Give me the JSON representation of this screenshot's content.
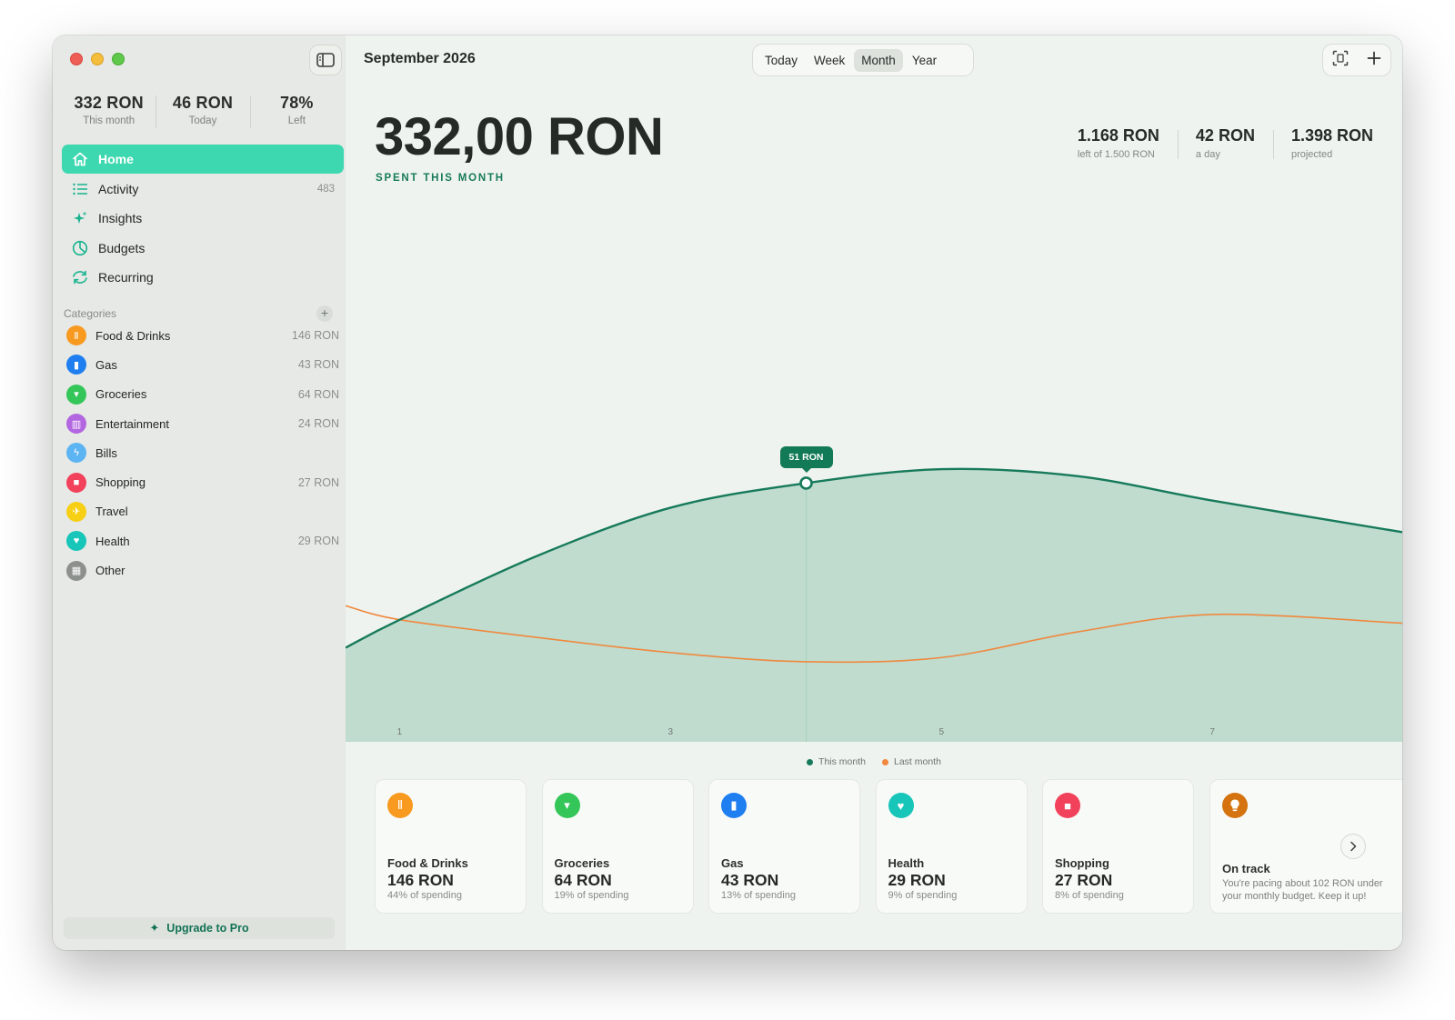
{
  "sidebar": {
    "stats": [
      {
        "value": "332 RON",
        "label": "This month"
      },
      {
        "value": "46 RON",
        "label": "Today"
      },
      {
        "value": "78%",
        "label": "Left"
      }
    ],
    "nav": [
      {
        "label": "Home",
        "icon": "house-icon",
        "active": true
      },
      {
        "label": "Activity",
        "icon": "list-icon",
        "count": "483"
      },
      {
        "label": "Insights",
        "icon": "sparkles-icon"
      },
      {
        "label": "Budgets",
        "icon": "pie-chart-icon"
      },
      {
        "label": "Recurring",
        "icon": "recurring-arrows-icon"
      }
    ],
    "categories_header": "Categories",
    "categories": [
      {
        "name": "Food & Drinks",
        "amount": "146 RON",
        "color": "#f79a1f",
        "icon": "fork-knife-icon"
      },
      {
        "name": "Gas",
        "amount": "43 RON",
        "color": "#1f7ef0",
        "icon": "fuel-pump-icon"
      },
      {
        "name": "Groceries",
        "amount": "64 RON",
        "color": "#34c659",
        "icon": "cart-icon"
      },
      {
        "name": "Entertainment",
        "amount": "24 RON",
        "color": "#b266e0",
        "icon": "popcorn-icon"
      },
      {
        "name": "Bills",
        "amount": "",
        "color": "#5db4f2",
        "icon": "bolt-icon"
      },
      {
        "name": "Shopping",
        "amount": "27 RON",
        "color": "#f2415b",
        "icon": "bag-icon"
      },
      {
        "name": "Travel",
        "amount": "",
        "color": "#f7cf14",
        "icon": "airplane-icon"
      },
      {
        "name": "Health",
        "amount": "29 RON",
        "color": "#17c5b9",
        "icon": "heart-icon"
      },
      {
        "name": "Other",
        "amount": "",
        "color": "#8d918e",
        "icon": "grid-icon"
      }
    ],
    "upgrade_label": "Upgrade to Pro"
  },
  "header": {
    "period": "September 2026",
    "segments": [
      "Today",
      "Week",
      "Month",
      "Year"
    ],
    "selected_segment": "Month"
  },
  "summary": {
    "amount": "332,00 RON",
    "caption": "SPENT THIS MONTH",
    "kpis": [
      {
        "value": "1.168 RON",
        "label": "left of 1.500 RON"
      },
      {
        "value": "42 RON",
        "label": "a day"
      },
      {
        "value": "1.398 RON",
        "label": "projected"
      }
    ]
  },
  "chart_data": {
    "type": "area",
    "x_ticks": [
      "1",
      "3",
      "5",
      "7"
    ],
    "series": [
      {
        "name": "This month",
        "color": "#177a5b",
        "x": [
          0.6,
          1,
          2,
          3,
          4,
          5,
          6,
          7,
          8.4
        ],
        "values": [
          4,
          12,
          30,
          44,
          51,
          55,
          53,
          46,
          37
        ]
      },
      {
        "name": "Last month",
        "color": "#f0883e",
        "x": [
          0.6,
          1,
          2,
          3,
          4,
          5,
          6,
          7,
          8.4
        ],
        "values": [
          16,
          12,
          7,
          2.6,
          0,
          1.2,
          8.5,
          13.5,
          11
        ]
      }
    ],
    "xlim": [
      0.6,
      8.4
    ],
    "ylim": [
      -33,
      75
    ],
    "highlight": {
      "x": 4,
      "label": "51 RON"
    }
  },
  "cards": [
    {
      "name": "Food & Drinks",
      "amount": "146 RON",
      "pct": "44% of spending",
      "color": "#f79a1f",
      "icon": "fork-knife-icon"
    },
    {
      "name": "Groceries",
      "amount": "64 RON",
      "pct": "19% of spending",
      "color": "#34c659",
      "icon": "cart-icon"
    },
    {
      "name": "Gas",
      "amount": "43 RON",
      "pct": "13% of spending",
      "color": "#1f7ef0",
      "icon": "fuel-pump-icon"
    },
    {
      "name": "Health",
      "amount": "29 RON",
      "pct": "9% of spending",
      "color": "#17c5b9",
      "icon": "heart-icon"
    },
    {
      "name": "Shopping",
      "amount": "27 RON",
      "pct": "8% of spending",
      "color": "#f2415b",
      "icon": "bag-icon"
    }
  ],
  "track_card": {
    "title": "On track",
    "line1": "You're pacing about 102 RON under",
    "line2": "your monthly budget. Keep it up!",
    "color": "#d4730f",
    "icon": "lightbulb-icon"
  }
}
